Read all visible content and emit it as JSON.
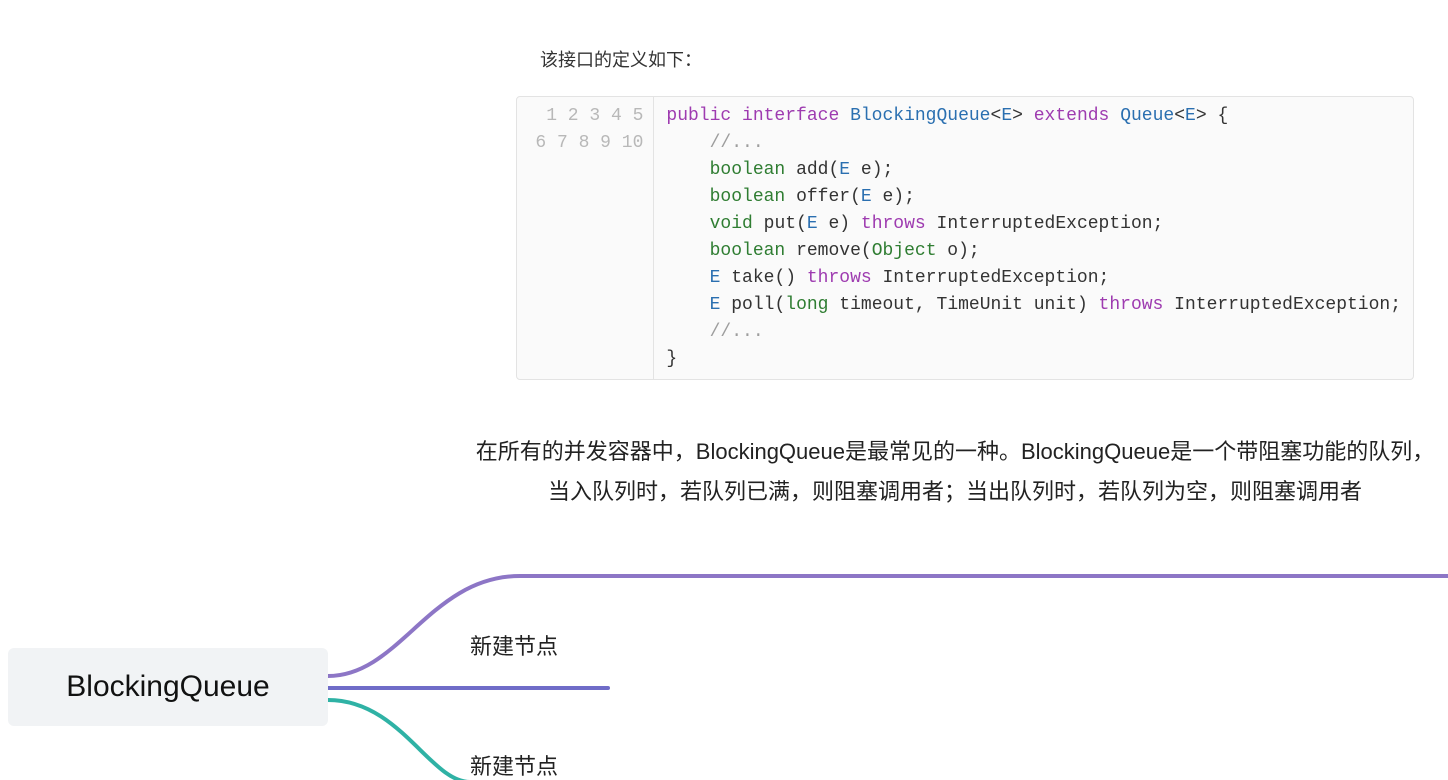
{
  "intro_text": "该接口的定义如下：",
  "code": {
    "line_numbers": [
      "1",
      "2",
      "3",
      "4",
      "5",
      "6",
      "7",
      "8",
      "9",
      "10"
    ],
    "lines": [
      [
        {
          "t": "public",
          "c": "tok-kw"
        },
        {
          "t": " "
        },
        {
          "t": "interface",
          "c": "tok-kw"
        },
        {
          "t": " "
        },
        {
          "t": "BlockingQueue",
          "c": "tok-name"
        },
        {
          "t": "<"
        },
        {
          "t": "E",
          "c": "tok-name"
        },
        {
          "t": ">"
        },
        {
          "t": " "
        },
        {
          "t": "extends",
          "c": "tok-kw"
        },
        {
          "t": " "
        },
        {
          "t": "Queue",
          "c": "tok-name"
        },
        {
          "t": "<"
        },
        {
          "t": "E",
          "c": "tok-name"
        },
        {
          "t": ">"
        },
        {
          "t": " {"
        }
      ],
      [
        {
          "t": "    "
        },
        {
          "t": "//...",
          "c": "tok-cmnt"
        }
      ],
      [
        {
          "t": "    "
        },
        {
          "t": "boolean",
          "c": "tok-type"
        },
        {
          "t": " "
        },
        {
          "t": "add",
          "c": "tok-fn"
        },
        {
          "t": "("
        },
        {
          "t": "E",
          "c": "tok-name"
        },
        {
          "t": " e);"
        }
      ],
      [
        {
          "t": "    "
        },
        {
          "t": "boolean",
          "c": "tok-type"
        },
        {
          "t": " "
        },
        {
          "t": "offer",
          "c": "tok-fn"
        },
        {
          "t": "("
        },
        {
          "t": "E",
          "c": "tok-name"
        },
        {
          "t": " e);"
        }
      ],
      [
        {
          "t": "    "
        },
        {
          "t": "void",
          "c": "tok-type"
        },
        {
          "t": " "
        },
        {
          "t": "put",
          "c": "tok-fn"
        },
        {
          "t": "("
        },
        {
          "t": "E",
          "c": "tok-name"
        },
        {
          "t": " e) "
        },
        {
          "t": "throws",
          "c": "tok-kw"
        },
        {
          "t": " InterruptedException;"
        }
      ],
      [
        {
          "t": "    "
        },
        {
          "t": "boolean",
          "c": "tok-type"
        },
        {
          "t": " "
        },
        {
          "t": "remove",
          "c": "tok-fn"
        },
        {
          "t": "("
        },
        {
          "t": "Object",
          "c": "tok-type"
        },
        {
          "t": " o);"
        }
      ],
      [
        {
          "t": "    "
        },
        {
          "t": "E",
          "c": "tok-name"
        },
        {
          "t": " "
        },
        {
          "t": "take",
          "c": "tok-fn"
        },
        {
          "t": "() "
        },
        {
          "t": "throws",
          "c": "tok-kw"
        },
        {
          "t": " InterruptedException;"
        }
      ],
      [
        {
          "t": "    "
        },
        {
          "t": "E",
          "c": "tok-name"
        },
        {
          "t": " "
        },
        {
          "t": "poll",
          "c": "tok-fn"
        },
        {
          "t": "("
        },
        {
          "t": "long",
          "c": "tok-type"
        },
        {
          "t": " timeout, TimeUnit unit) "
        },
        {
          "t": "throws",
          "c": "tok-kw"
        },
        {
          "t": " InterruptedException;"
        }
      ],
      [
        {
          "t": "    "
        },
        {
          "t": "//...",
          "c": "tok-cmnt"
        }
      ],
      [
        {
          "t": "}"
        }
      ]
    ]
  },
  "description": "在所有的并发容器中，BlockingQueue是最常见的一种。BlockingQueue是一个带阻塞功能的队列，当入队列时，若队列已满，则阻塞调用者；当出队列时，若队列为空，则阻塞调用者",
  "mindmap": {
    "root_label": "BlockingQueue",
    "children": [
      {
        "label": "新建节点"
      },
      {
        "label": "新建节点"
      }
    ],
    "colors": {
      "branch_top": "#8d76c6",
      "branch_mid": "#6f6cc8",
      "branch_bot": "#2fb2a5"
    }
  }
}
